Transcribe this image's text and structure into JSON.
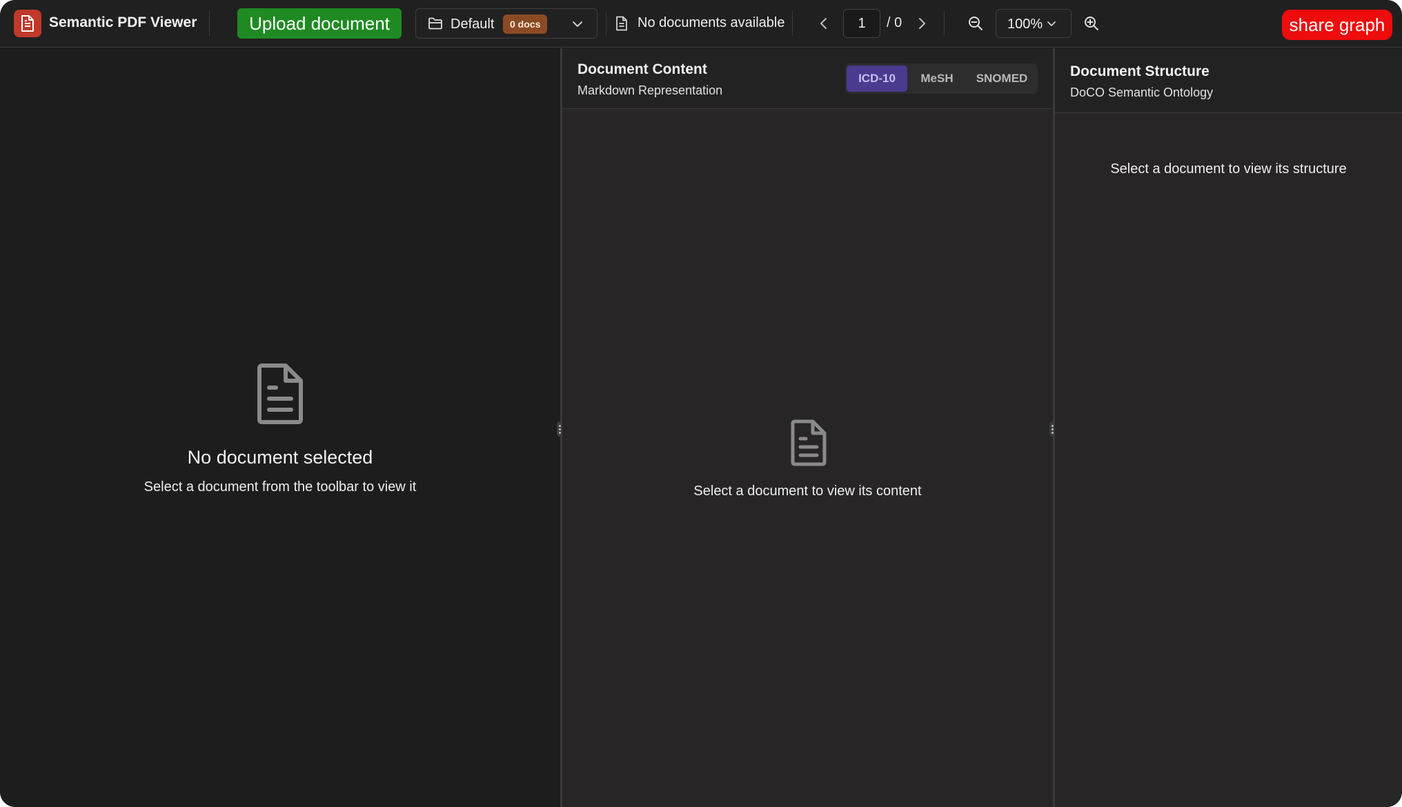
{
  "app": {
    "title": "Semantic PDF Viewer"
  },
  "toolbar": {
    "upload_label": "Upload document",
    "collection": {
      "name": "Default",
      "badge": "0 docs"
    },
    "doc_status": "No documents available",
    "page": {
      "current": "1",
      "total": "/ 0"
    },
    "zoom": "100%",
    "share_label": "share graph"
  },
  "left_panel": {
    "empty_title": "No document selected",
    "empty_text": "Select a document from the toolbar to view it"
  },
  "content_panel": {
    "title": "Document Content",
    "subtitle": "Markdown Representation",
    "tabs": [
      {
        "label": "ICD-10",
        "active": true
      },
      {
        "label": "MeSH",
        "active": false
      },
      {
        "label": "SNOMED",
        "active": false
      }
    ],
    "empty_text": "Select a document to view its content"
  },
  "structure_panel": {
    "title": "Document Structure",
    "subtitle": "DoCO Semantic Ontology",
    "empty_text": "Select a document to view its structure"
  },
  "colors": {
    "upload": "#1f8a22",
    "share": "#ee0c0c",
    "badge": "#8b4a24",
    "active_tab": "#4b3a8e",
    "logo": "#c0392b"
  }
}
